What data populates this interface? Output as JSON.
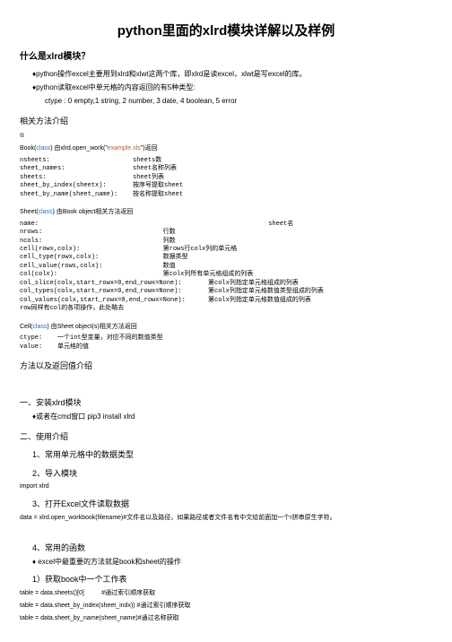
{
  "title": "python里面的xlrd模块详解以及样例",
  "h_whatis": "什么是xlrd模块？",
  "b1": "♦python操作excel主要用到xlrd和xlwt这两个库，即xlrd是读excel，xlwt是写excel的库。",
  "b2": "♦python读取excel中单元格的内容返回的有5种类型:",
  "b3": "ctype :  0 empty,1 string, 2 number, 3 date, 4 boolean, 5 error",
  "h_methods": "相关方法介绍",
  "icon": "⧉",
  "book_line_pre": "Book(",
  "book_line_class": "class",
  "book_line_mid": ") 由xlrd.open_work(\"",
  "book_line_str": "example.xls",
  "book_line_post": "\")返回",
  "book_block": "nsheets:                      sheets数\nsheet_names:                  sheet名称列表\nsheets:                       sheet列表\nsheet_by_index(sheetx):       按序号提取sheet\nsheet_by_name(sheet_name):    按名称提取sheet",
  "sheet_line_pre": "Sheet(",
  "sheet_line_class": "class",
  "sheet_line_post": ") 由Book object相关方法返回",
  "sheet_block": "name:                                                             sheet名\nnrows:                                行数\nncols:                                列数\ncell(rowx,colx):                      第rows行colx列的单元格\ncell_type(rowx,colx):                 数据类型\ncell_value(rows,colx):                数值\ncol(colx):                            第colx列所有单元格组成的列表\ncol_slice(colx,start_rowx=0,end_rowx=None):       第colx列指定单元格组成的列表\ncol_types(colx,start_rowx=0,end_rowx=None):       第colx列指定单元格数值类型组成的列表\ncol_values(colx,start_rowx=0,end_rowx=None):      第colx列指定单元格数值组成的列表\nrow同样有col的各项操作，此处略去",
  "cell_line_pre": "Cell(",
  "cell_line_class": "class",
  "cell_line_post": ") 由Sheet object(s)相关方法返回",
  "cell_block": "ctype:    一个int型变量，对应不同的数值类型\nvalue:    单元格的值",
  "h_usage": "方法以及返回值介绍",
  "sec1": "一、安装xlrd模块",
  "sec1_b": "♦或者在cmd窗口  pip3 install  xlrd",
  "sec2": "二、使用介绍",
  "sec2_1": "1、常用单元格中的数据类型",
  "sec2_2": "2、导入模块",
  "import_line": "import xlrd",
  "sec2_3": "3、打开Excel文件读取数据",
  "data_line": "data = xlrd.open_workbook(filename)#文件名以及路径，如果路径或者文件名有中文给前面加一个r拼串原生字符。",
  "sec2_4": "4、常用的函数",
  "sec2_4b": "♦ excel中最重要的方法就是book和sheet的操作",
  "sec2_4_1": "1）获取book中一个工作表",
  "t1": "table = data.sheets()[0]          #通过索引顺序获取",
  "t2": "table = data.sheet_by_index(sheet_indx)) #通过索引顺序获取",
  "t3": "table = data.sheet_by_name(sheet_name)#通过名称获取"
}
